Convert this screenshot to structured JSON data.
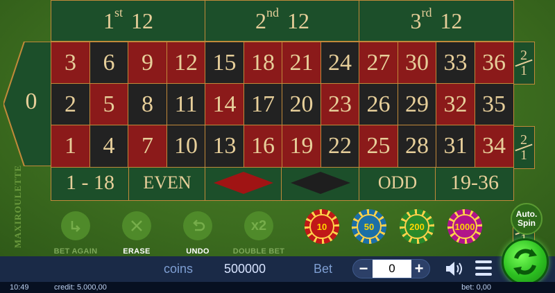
{
  "brand": "MAXIROULETTE",
  "dozens": [
    {
      "ord": "1",
      "sup": "st",
      "num": "12"
    },
    {
      "ord": "2",
      "sup": "nd",
      "num": "12"
    },
    {
      "ord": "3",
      "sup": "rd",
      "num": "12"
    }
  ],
  "zero": "0",
  "rows": [
    [
      {
        "n": "3",
        "c": "red"
      },
      {
        "n": "6",
        "c": "black"
      },
      {
        "n": "9",
        "c": "red"
      },
      {
        "n": "12",
        "c": "red"
      },
      {
        "n": "15",
        "c": "black"
      },
      {
        "n": "18",
        "c": "red"
      },
      {
        "n": "21",
        "c": "red"
      },
      {
        "n": "24",
        "c": "black"
      },
      {
        "n": "27",
        "c": "red"
      },
      {
        "n": "30",
        "c": "red"
      },
      {
        "n": "33",
        "c": "black"
      },
      {
        "n": "36",
        "c": "red"
      }
    ],
    [
      {
        "n": "2",
        "c": "black"
      },
      {
        "n": "5",
        "c": "red"
      },
      {
        "n": "8",
        "c": "black"
      },
      {
        "n": "11",
        "c": "black"
      },
      {
        "n": "14",
        "c": "red"
      },
      {
        "n": "17",
        "c": "black"
      },
      {
        "n": "20",
        "c": "black"
      },
      {
        "n": "23",
        "c": "red"
      },
      {
        "n": "26",
        "c": "black"
      },
      {
        "n": "29",
        "c": "black"
      },
      {
        "n": "32",
        "c": "red"
      },
      {
        "n": "35",
        "c": "black"
      }
    ],
    [
      {
        "n": "1",
        "c": "red"
      },
      {
        "n": "4",
        "c": "black"
      },
      {
        "n": "7",
        "c": "red"
      },
      {
        "n": "10",
        "c": "black"
      },
      {
        "n": "13",
        "c": "black"
      },
      {
        "n": "16",
        "c": "red"
      },
      {
        "n": "19",
        "c": "red"
      },
      {
        "n": "22",
        "c": "black"
      },
      {
        "n": "25",
        "c": "red"
      },
      {
        "n": "28",
        "c": "black"
      },
      {
        "n": "31",
        "c": "black"
      },
      {
        "n": "34",
        "c": "red"
      }
    ]
  ],
  "column_bet": {
    "top": "2",
    "bottom": "1"
  },
  "outside": {
    "low": "1 - 18",
    "even": "EVEN",
    "odd": "ODD",
    "high": "19-36"
  },
  "controls": {
    "bet_again": "BET AGAIN",
    "erase": "ERASE",
    "undo": "UNDO",
    "double_bet": "DOUBLE BET",
    "double_icon": "x2"
  },
  "chips": [
    {
      "value": "10",
      "color": "#c01818",
      "text": "#ffd700"
    },
    {
      "value": "50",
      "color": "#1c6fa6",
      "text": "#ffd700"
    },
    {
      "value": "200",
      "color": "#2a8a2a",
      "text": "#ffd700"
    },
    {
      "value": "1000",
      "color": "#b0148a",
      "text": "#ffd700"
    }
  ],
  "autospin": {
    "line1": "Auto.",
    "line2": "Spin"
  },
  "bottom": {
    "coins_label": "coins",
    "coins_value": "500000",
    "bet_label": "Bet",
    "bet_value": "0",
    "minus": "−",
    "plus": "+"
  },
  "status": {
    "time": "10:49",
    "credit": "credit: 5.000,00",
    "bet": "bet: 0,00"
  },
  "colors": {
    "red": "#8b1a1a",
    "black": "#222222",
    "felt": "#3c6c1f",
    "border": "#c28a3a",
    "text": "#e7cf9a"
  }
}
